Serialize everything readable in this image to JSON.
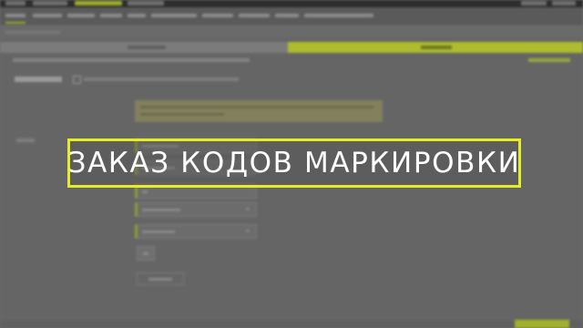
{
  "overlay": {
    "title": "ЗАКАЗ КОДОВ МАРКИРОВКИ"
  },
  "colors": {
    "accent": "#aebc2e",
    "overlay_border": "#e6ec2a",
    "overlay_text": "#ffffff",
    "topbar": "#2c2c2c",
    "background": "#656565"
  },
  "steps": [
    {
      "label": "",
      "active": false
    },
    {
      "label": "",
      "active": true
    }
  ],
  "form": {
    "fields": [
      {
        "value": "",
        "type": "text"
      },
      {
        "value": "",
        "type": "text"
      },
      {
        "value": "",
        "type": "select"
      },
      {
        "value": "",
        "type": "select"
      }
    ]
  },
  "icons": {
    "select_caret": "chevron-down-icon"
  }
}
